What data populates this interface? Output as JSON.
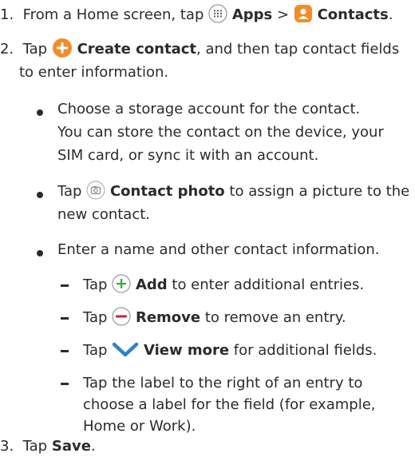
{
  "steps": [
    {
      "num": "1.",
      "pre": "From a Home screen, tap",
      "apps_label": "Apps",
      "sep": ">",
      "contacts_label": "Contacts",
      "post": "."
    },
    {
      "num": "2.",
      "pre": "Tap",
      "create_label": "Create contact",
      "post1": ", and then tap contact fields",
      "post2": "to enter information."
    },
    {
      "num": "3.",
      "pre": "Tap",
      "save_label": "Save",
      "post": "."
    }
  ],
  "bullets": [
    {
      "l1": "Choose a storage account for the contact.",
      "l2": "You can store the contact on the device, your",
      "l3": "SIM card, or sync it with an account."
    },
    {
      "pre": "Tap",
      "label": "Contact photo",
      "post": "to assign a picture to the",
      "l2": "new contact."
    },
    {
      "l1": "Enter a name and other contact information."
    }
  ],
  "subitems": [
    {
      "pre": "Tap",
      "label": "Add",
      "post": "to enter additional entries."
    },
    {
      "pre": "Tap",
      "label": "Remove",
      "post": "to remove an entry."
    },
    {
      "pre": "Tap",
      "label": "View more",
      "post": "for additional fields."
    },
    {
      "l1": "Tap the label to the right of an entry to",
      "l2": "choose a label for the field (for example,",
      "l3": "Home or Work)."
    }
  ],
  "colors": {
    "text": "#2b2b2b",
    "accent": "#f28c28",
    "add_green": "#3aa640",
    "remove_red": "#d0213d",
    "chevron_blue": "#2f7fd0",
    "icon_gray": "#9a9a9a"
  },
  "icons": [
    "apps-icon",
    "contacts-icon",
    "create-contact-icon",
    "camera-icon",
    "add-icon",
    "remove-icon",
    "view-more-icon"
  ]
}
